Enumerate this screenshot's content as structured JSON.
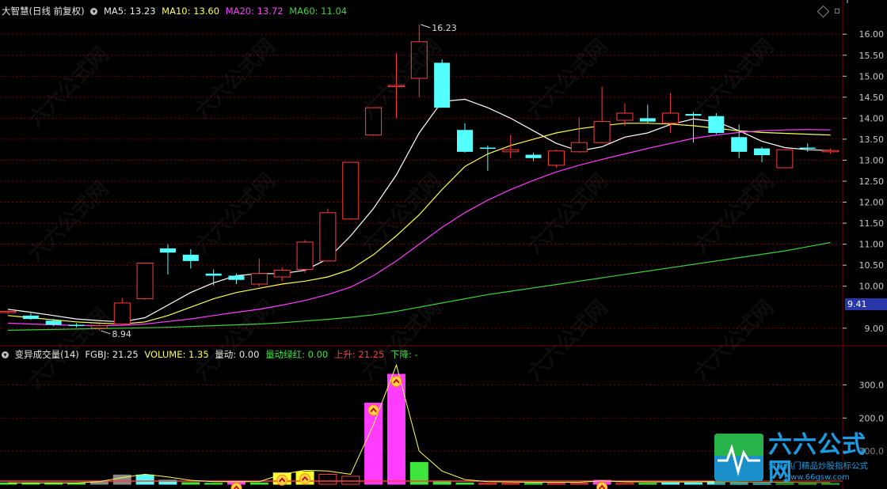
{
  "main_header": {
    "title": "大智慧(日线 前复权)",
    "ma5": "MA5: 13.23",
    "ma10": "MA10: 13.60",
    "ma20": "MA20: 13.72",
    "ma60": "MA60: 11.04"
  },
  "sub_header": {
    "title": "变异成交量(14)",
    "fgbj": "FGBJ: 21.25",
    "volume": "VOLUME: 1.35",
    "liangdong": "量动: 0.00",
    "liangdong_lvhong": "量动绿红: 0.00",
    "shangsheng": "上升: 21.25",
    "xiajiang": "下降: -"
  },
  "price_axis": {
    "ticks": [
      "16.00",
      "15.50",
      "15.00",
      "14.50",
      "14.00",
      "13.50",
      "13.00",
      "12.50",
      "12.00",
      "11.50",
      "11.00",
      "10.50",
      "10.00",
      "9.00"
    ],
    "current_price": "9.41"
  },
  "volume_axis": {
    "ticks": [
      "300.0",
      "200.0",
      "100.0"
    ]
  },
  "annotations": {
    "high": "16.23",
    "low": "8.94"
  },
  "watermark": {
    "title": "六六公式网",
    "subtitle": "聚焦热门精品炒股指标公式",
    "url": "www.66gsw.com"
  },
  "colors": {
    "up": "#ff3c3c",
    "down": "#54ffff",
    "ma5": "#ffffff",
    "ma10": "#ffff4e",
    "ma20": "#ff3cff",
    "ma60": "#3cd23c",
    "grid": "#7a0000",
    "axis": "#c8c8c8"
  },
  "chart_data": [
    {
      "type": "candlestick",
      "ylabel": "",
      "ylim": [
        8.6,
        16.4
      ],
      "candles": [
        {
          "o": 9.38,
          "h": 9.42,
          "l": 9.34,
          "c": 9.4
        },
        {
          "o": 9.3,
          "h": 9.36,
          "l": 9.2,
          "c": 9.22
        },
        {
          "o": 9.18,
          "h": 9.22,
          "l": 9.05,
          "c": 9.08
        },
        {
          "o": 9.08,
          "h": 9.12,
          "l": 9.02,
          "c": 9.06
        },
        {
          "o": 9.0,
          "h": 9.1,
          "l": 8.94,
          "c": 9.06
        },
        {
          "o": 9.1,
          "h": 9.72,
          "l": 9.05,
          "c": 9.6
        },
        {
          "o": 9.7,
          "h": 10.55,
          "l": 9.68,
          "c": 10.55
        },
        {
          "o": 10.9,
          "h": 11.0,
          "l": 10.28,
          "c": 10.8
        },
        {
          "o": 10.75,
          "h": 10.88,
          "l": 10.42,
          "c": 10.6
        },
        {
          "o": 10.3,
          "h": 10.4,
          "l": 10.02,
          "c": 10.25
        },
        {
          "o": 10.25,
          "h": 10.3,
          "l": 10.05,
          "c": 10.15
        },
        {
          "o": 10.05,
          "h": 10.66,
          "l": 10.0,
          "c": 10.3
        },
        {
          "o": 10.22,
          "h": 10.45,
          "l": 10.12,
          "c": 10.38
        },
        {
          "o": 10.4,
          "h": 11.1,
          "l": 10.32,
          "c": 11.05
        },
        {
          "o": 10.6,
          "h": 11.85,
          "l": 10.6,
          "c": 11.75
        },
        {
          "o": 11.6,
          "h": 12.0,
          "l": 11.58,
          "c": 12.95
        },
        {
          "o": 13.6,
          "h": 14.25,
          "l": 13.58,
          "c": 14.25
        },
        {
          "o": 14.75,
          "h": 15.55,
          "l": 14.0,
          "c": 14.78
        },
        {
          "o": 14.95,
          "h": 16.23,
          "l": 14.5,
          "c": 15.82
        },
        {
          "o": 15.32,
          "h": 15.4,
          "l": 14.25,
          "c": 14.25
        },
        {
          "o": 13.72,
          "h": 13.88,
          "l": 13.18,
          "c": 13.2
        },
        {
          "o": 13.3,
          "h": 13.35,
          "l": 12.75,
          "c": 13.28
        },
        {
          "o": 13.2,
          "h": 13.6,
          "l": 13.05,
          "c": 13.25
        },
        {
          "o": 13.13,
          "h": 13.18,
          "l": 12.98,
          "c": 13.05
        },
        {
          "o": 12.88,
          "h": 13.25,
          "l": 12.82,
          "c": 13.22
        },
        {
          "o": 13.2,
          "h": 14.02,
          "l": 13.18,
          "c": 13.42
        },
        {
          "o": 13.42,
          "h": 14.75,
          "l": 13.4,
          "c": 13.92
        },
        {
          "o": 13.95,
          "h": 14.35,
          "l": 13.82,
          "c": 14.12
        },
        {
          "o": 14.0,
          "h": 14.32,
          "l": 13.88,
          "c": 13.92
        },
        {
          "o": 13.88,
          "h": 14.6,
          "l": 13.65,
          "c": 14.12
        },
        {
          "o": 14.1,
          "h": 14.15,
          "l": 13.42,
          "c": 14.06
        },
        {
          "o": 14.05,
          "h": 14.12,
          "l": 13.62,
          "c": 13.65
        },
        {
          "o": 13.55,
          "h": 13.85,
          "l": 13.05,
          "c": 13.2
        },
        {
          "o": 13.28,
          "h": 13.32,
          "l": 12.95,
          "c": 13.12
        },
        {
          "o": 12.82,
          "h": 13.25,
          "l": 12.82,
          "c": 13.25
        },
        {
          "o": 13.3,
          "h": 13.4,
          "l": 13.2,
          "c": 13.28
        },
        {
          "o": 13.2,
          "h": 13.28,
          "l": 13.15,
          "c": 13.23
        }
      ],
      "series": [
        {
          "name": "MA5",
          "values": [
            9.45,
            9.38,
            9.3,
            9.22,
            9.18,
            9.15,
            9.25,
            9.55,
            9.85,
            10.08,
            10.25,
            10.3,
            10.3,
            10.38,
            10.65,
            11.2,
            11.85,
            12.65,
            13.65,
            14.4,
            14.45,
            14.25,
            14.0,
            13.7,
            13.4,
            13.22,
            13.32,
            13.55,
            13.65,
            13.85,
            13.98,
            13.92,
            13.7,
            13.45,
            13.3,
            13.25,
            13.23
          ]
        },
        {
          "name": "MA10",
          "values": [
            9.3,
            9.25,
            9.2,
            9.15,
            9.12,
            9.1,
            9.15,
            9.3,
            9.5,
            9.7,
            9.85,
            9.95,
            10.05,
            10.12,
            10.22,
            10.4,
            10.75,
            11.2,
            11.7,
            12.3,
            12.85,
            13.15,
            13.35,
            13.5,
            13.65,
            13.75,
            13.82,
            13.88,
            13.88,
            13.86,
            13.82,
            13.76,
            13.7,
            13.66,
            13.64,
            13.62,
            13.6
          ]
        },
        {
          "name": "MA20",
          "values": [
            9.12,
            9.1,
            9.08,
            9.07,
            9.06,
            9.07,
            9.1,
            9.16,
            9.22,
            9.3,
            9.38,
            9.45,
            9.55,
            9.66,
            9.8,
            9.98,
            10.25,
            10.6,
            11.0,
            11.4,
            11.75,
            12.05,
            12.3,
            12.52,
            12.72,
            12.88,
            13.02,
            13.15,
            13.28,
            13.4,
            13.52,
            13.6,
            13.66,
            13.7,
            13.72,
            13.73,
            13.72
          ]
        },
        {
          "name": "MA60",
          "values": [
            8.95,
            8.96,
            8.97,
            8.98,
            8.99,
            9.0,
            9.01,
            9.02,
            9.04,
            9.06,
            9.08,
            9.1,
            9.13,
            9.17,
            9.21,
            9.26,
            9.32,
            9.4,
            9.5,
            9.6,
            9.7,
            9.8,
            9.88,
            9.96,
            10.04,
            10.12,
            10.2,
            10.28,
            10.36,
            10.44,
            10.52,
            10.6,
            10.68,
            10.76,
            10.84,
            10.94,
            11.04
          ]
        }
      ]
    },
    {
      "type": "bar",
      "ylabel": "",
      "ylim": [
        0,
        375
      ],
      "bars": [
        {
          "v": 4,
          "c": "#3ce63c"
        },
        {
          "v": 4,
          "c": "#3ce63c"
        },
        {
          "v": 4,
          "c": "#3ce63c"
        },
        {
          "v": 3,
          "c": "#3ce63c"
        },
        {
          "v": 9,
          "c": "#888888"
        },
        {
          "v": 28,
          "c": "#888888"
        },
        {
          "v": 28,
          "c": "#54ffff"
        },
        {
          "v": 12,
          "c": "#54ffff"
        },
        {
          "v": 5,
          "c": "#3ce63c"
        },
        {
          "v": 3,
          "c": "#3ce63c"
        },
        {
          "v": 10,
          "c": "#ff3cff"
        },
        {
          "v": 4,
          "c": "#3ce63c"
        },
        {
          "v": 34,
          "c": "#ffff30"
        },
        {
          "v": 38,
          "c": "#ffff30"
        },
        {
          "v": 30,
          "c": "#000000"
        },
        {
          "v": 24,
          "c": "#000000"
        },
        {
          "v": 245,
          "c": "#ff3cff"
        },
        {
          "v": 332,
          "c": "#ff3cff"
        },
        {
          "v": 66,
          "c": "#3ce63c"
        },
        {
          "v": 10,
          "c": "#3ce63c"
        },
        {
          "v": 4,
          "c": "#3ce63c"
        },
        {
          "v": 3,
          "c": "#000000"
        },
        {
          "v": 3,
          "c": "#000000"
        },
        {
          "v": 3,
          "c": "#3ce63c"
        },
        {
          "v": 3,
          "c": "#000000"
        },
        {
          "v": 3,
          "c": "#000000"
        },
        {
          "v": 12,
          "c": "#ff3cff"
        },
        {
          "v": 4,
          "c": "#000000"
        },
        {
          "v": 3,
          "c": "#3ce63c"
        },
        {
          "v": 4,
          "c": "#54ffff"
        },
        {
          "v": 4,
          "c": "#54ffff"
        },
        {
          "v": 8,
          "c": "#54ffff"
        },
        {
          "v": 6,
          "c": "#54ffff"
        },
        {
          "v": 3,
          "c": "#54ffff"
        },
        {
          "v": 3,
          "c": "#3ce63c"
        },
        {
          "v": 3,
          "c": "#3ce63c"
        },
        {
          "v": 3,
          "c": "#3ce63c"
        }
      ],
      "arrow_markers": [
        10,
        12,
        13,
        16,
        17,
        26
      ],
      "series": [
        {
          "values": [
            4,
            4,
            4,
            4,
            8,
            20,
            30,
            22,
            12,
            8,
            8,
            8,
            30,
            42,
            40,
            30,
            180,
            360,
            100,
            40,
            14,
            8,
            7,
            6,
            6,
            6,
            10,
            8,
            7,
            7,
            7,
            8,
            7,
            6,
            6,
            5,
            5
          ]
        }
      ]
    }
  ]
}
